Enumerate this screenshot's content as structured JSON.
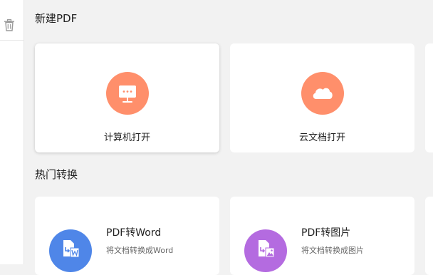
{
  "sidebar": {
    "icon": "trash-icon"
  },
  "sections": {
    "new_pdf_title": "新建PDF",
    "hot_title": "热门转换"
  },
  "open_cards": [
    {
      "label": "计算机打开",
      "icon": "computer-icon",
      "color": "#ff8f6b"
    },
    {
      "label": "云文档打开",
      "icon": "cloud-icon",
      "color": "#ff8f6b"
    }
  ],
  "convert_cards": [
    {
      "title": "PDF转Word",
      "desc": "将文档转换成Word",
      "icon": "pdf-to-word-icon",
      "color": "#4f86e8"
    },
    {
      "title": "PDF转图片",
      "desc": "将文档转换成图片",
      "icon": "pdf-to-image-icon",
      "color": "#b46be0"
    }
  ]
}
